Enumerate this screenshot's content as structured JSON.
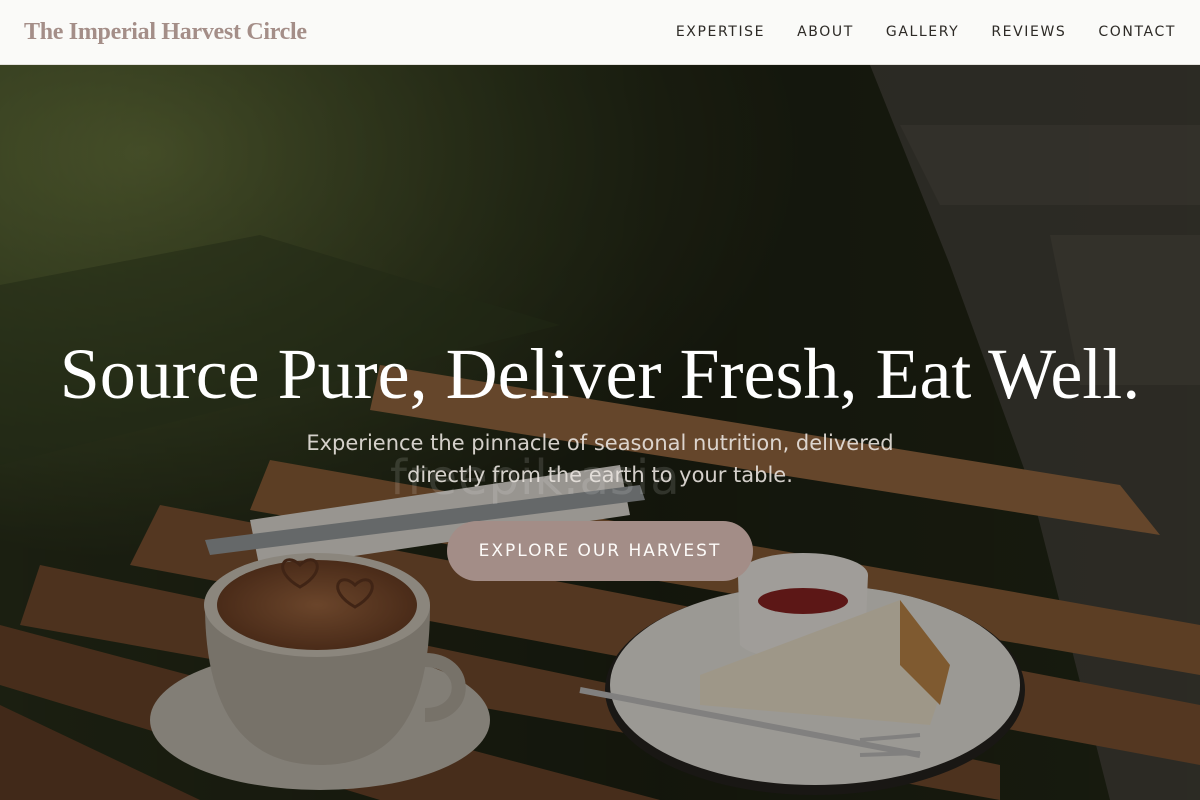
{
  "header": {
    "brand": "The Imperial Harvest Circle",
    "nav": [
      {
        "label": "EXPERTISE"
      },
      {
        "label": "ABOUT"
      },
      {
        "label": "GALLERY"
      },
      {
        "label": "REVIEWS"
      },
      {
        "label": "CONTACT"
      }
    ]
  },
  "hero": {
    "title": "Source Pure, Deliver Fresh, Eat Well.",
    "subtitle": "Experience the pinnacle of seasonal nutrition, delivered directly from the earth to your table.",
    "cta_label": "EXPLORE OUR HARVEST",
    "watermark": "freepik.asia",
    "background_image": "coffee-and-cheesecake-on-wooden-table-photo"
  },
  "colors": {
    "brand": "#a48e88",
    "cta": "#a38d87",
    "nav_background": "#fafaf8",
    "nav_text": "#2d2a26"
  }
}
